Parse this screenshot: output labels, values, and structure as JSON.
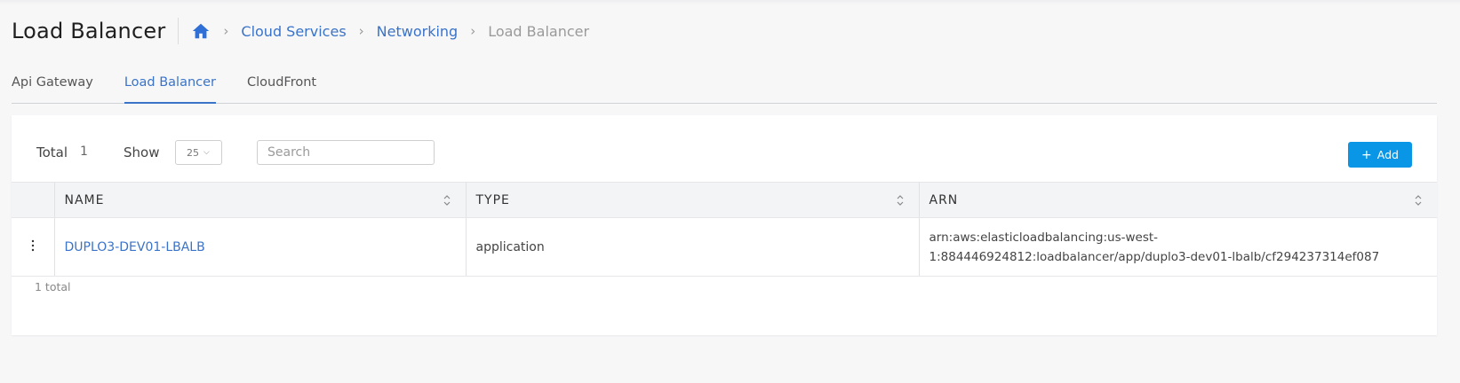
{
  "header": {
    "title": "Load Balancer",
    "breadcrumbs": [
      {
        "label": "Cloud Services"
      },
      {
        "label": "Networking"
      },
      {
        "label": "Load Balancer"
      }
    ]
  },
  "tabs": [
    {
      "label": "Api Gateway",
      "active": false
    },
    {
      "label": "Load Balancer",
      "active": true
    },
    {
      "label": "CloudFront",
      "active": false
    }
  ],
  "toolbar": {
    "total_label": "Total",
    "total_count": "1",
    "show_label": "Show",
    "page_size": "25",
    "search_placeholder": "Search",
    "search_value": "",
    "add_label": "Add"
  },
  "table": {
    "columns": [
      "NAME",
      "TYPE",
      "ARN"
    ],
    "rows": [
      {
        "name": "DUPLO3-DEV01-LBALB",
        "type": "application",
        "arn_line1": "arn:aws:elasticloadbalancing:us-west-",
        "arn_line2": "1:884446924812:loadbalancer/app/duplo3-dev01-lbalb/cf294237314ef087"
      }
    ],
    "footer": "1 total"
  },
  "colors": {
    "accent": "#3a73c8",
    "primary_button": "#0a96e6",
    "background": "#f7f7f8"
  },
  "icons": {
    "home": "home-icon",
    "breadcrumb_separator": "chevron-right-icon",
    "row_menu": "kebab-menu-icon",
    "sort": "sort-icon",
    "dropdown": "chevron-down-icon",
    "add": "plus-icon"
  }
}
